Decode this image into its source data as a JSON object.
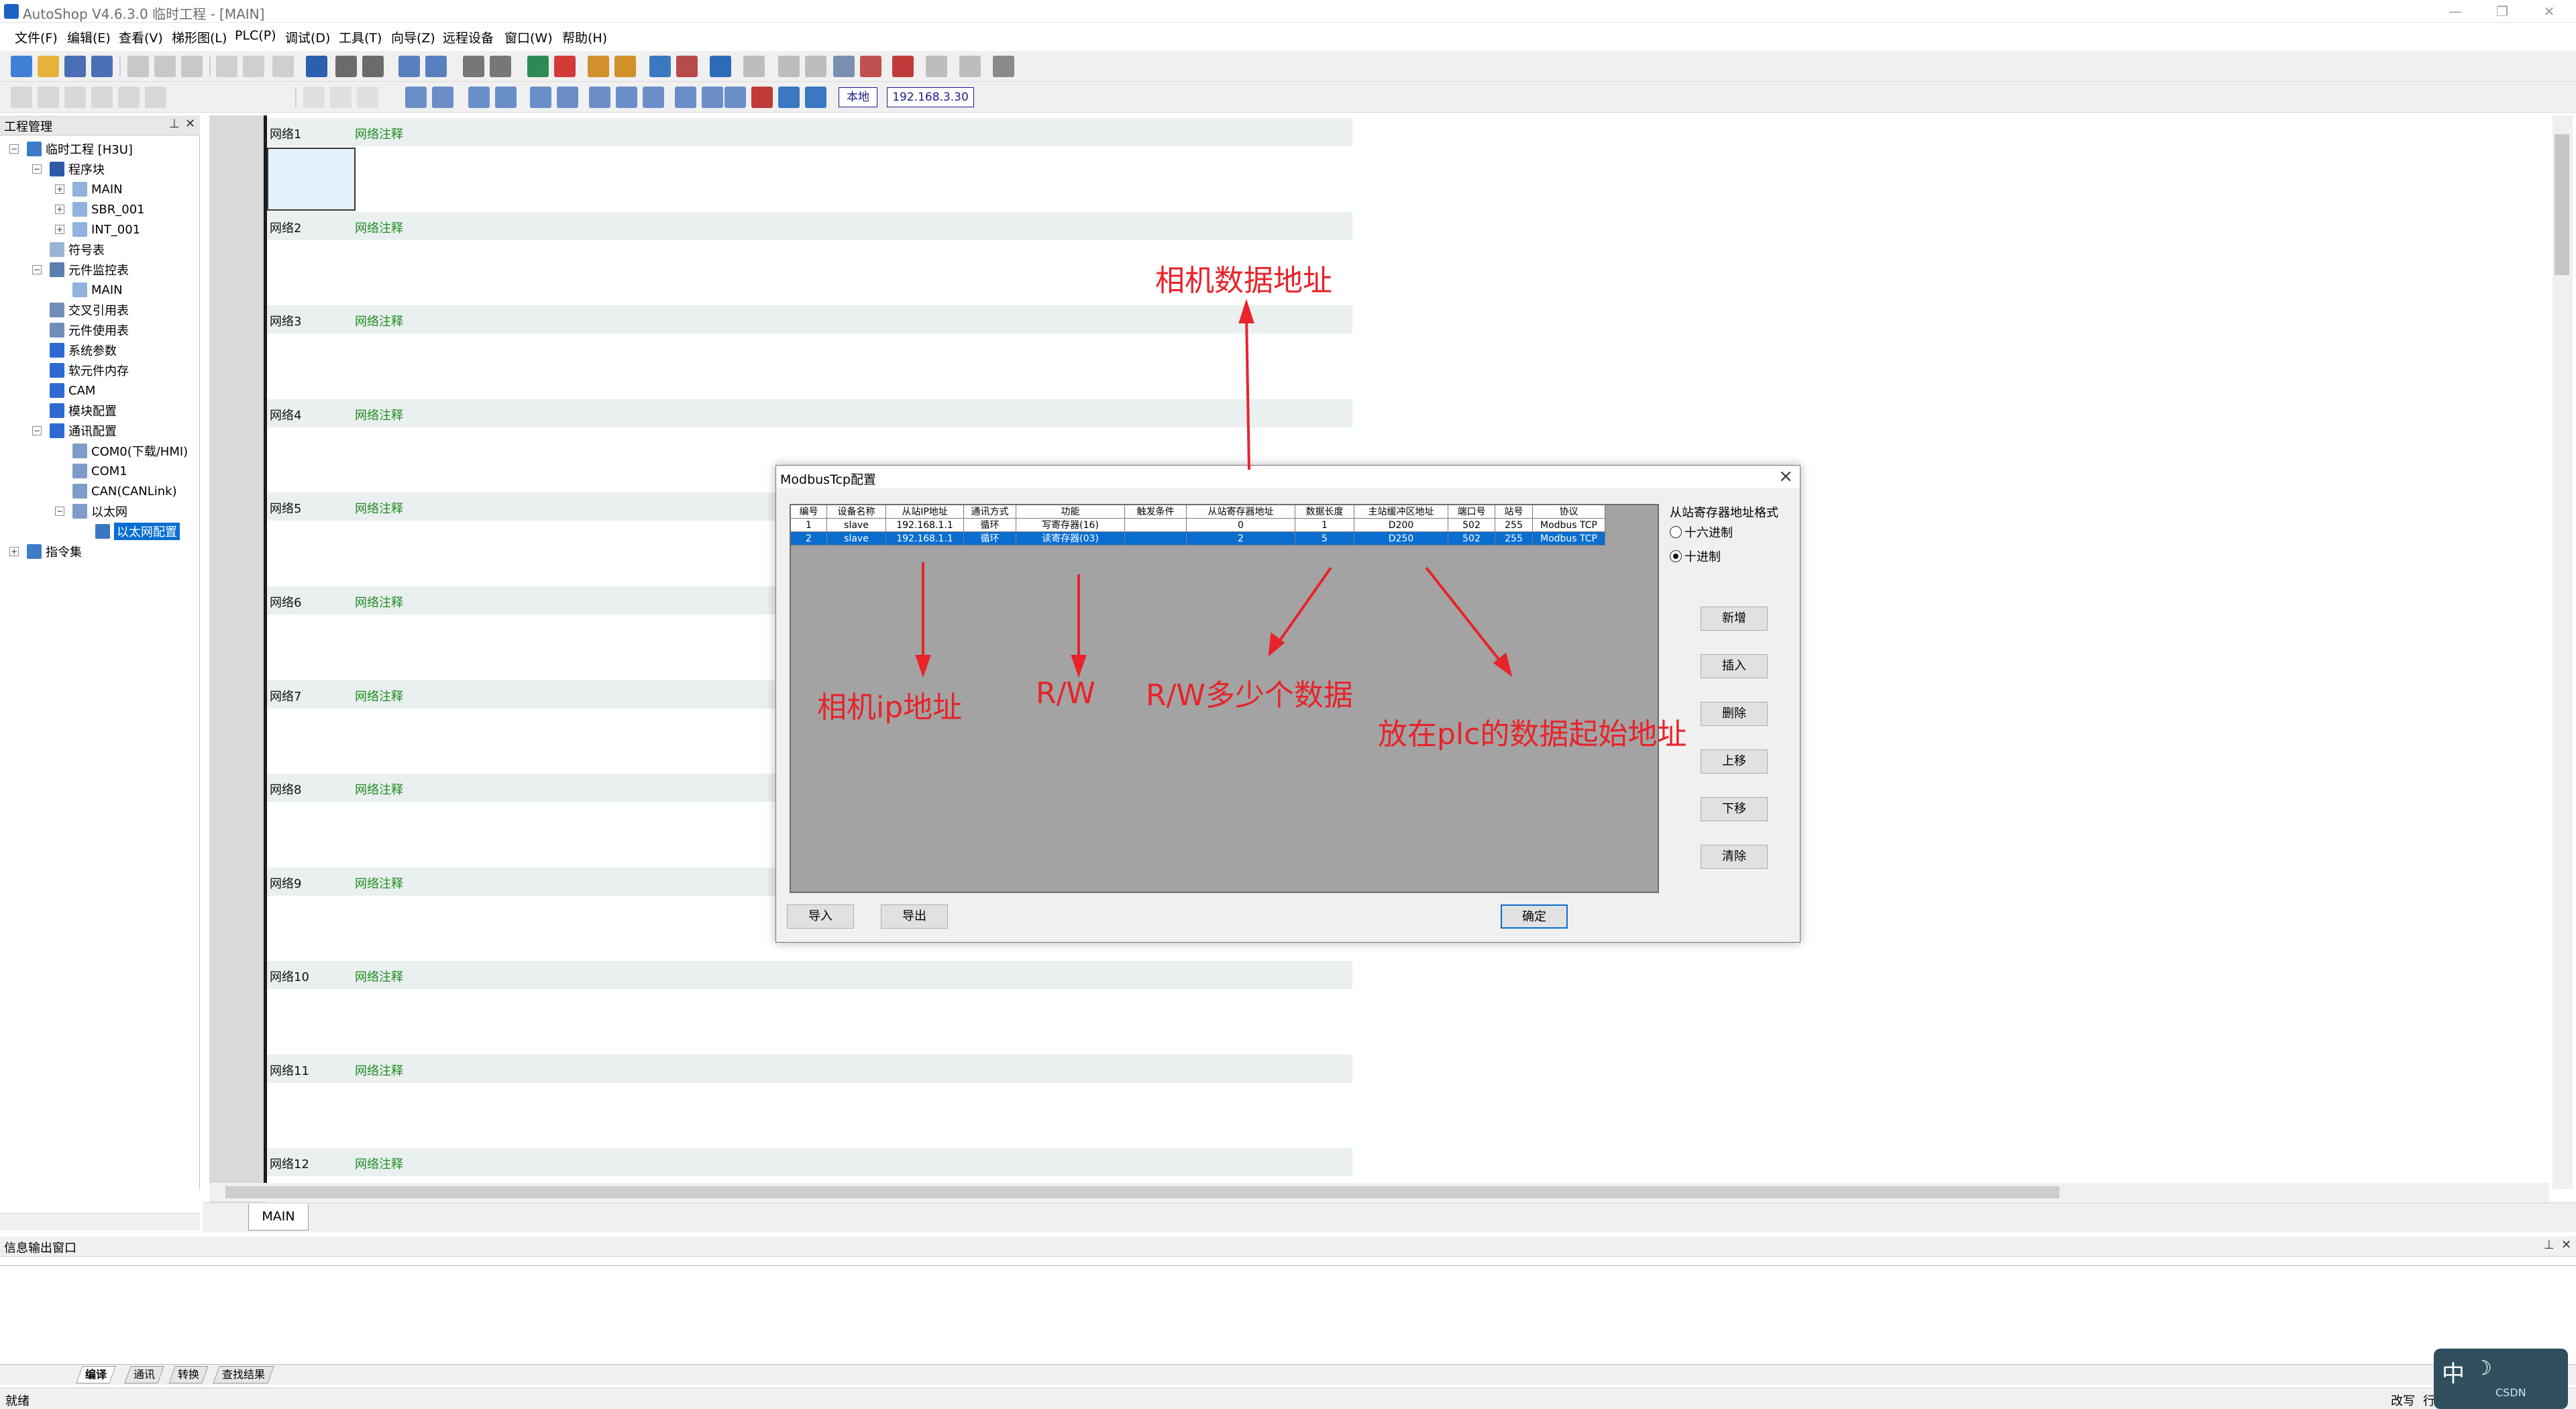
{
  "window": {
    "title": "AutoShop V4.6.3.0  临时工程 - [MAIN]",
    "minimize": "—",
    "restore": "❐",
    "close": "✕"
  },
  "menu": {
    "items": [
      "文件(F)",
      "编辑(E)",
      "查看(V)",
      "梯形图(L)",
      "PLC(P)",
      "调试(D)",
      "工具(T)",
      "向导(Z)",
      "远程设备",
      "窗口(W)",
      "帮助(H)"
    ]
  },
  "toolbar2": {
    "local_label": "本地",
    "ip_value": "192.168.3.30"
  },
  "project_panel": {
    "title": "工程管理",
    "tree": [
      {
        "label": "临时工程 [H3U]"
      },
      {
        "label": "程序块"
      },
      {
        "label": "MAIN"
      },
      {
        "label": "SBR_001"
      },
      {
        "label": "INT_001"
      },
      {
        "label": "符号表"
      },
      {
        "label": "元件监控表"
      },
      {
        "label": "MAIN"
      },
      {
        "label": "交叉引用表"
      },
      {
        "label": "元件使用表"
      },
      {
        "label": "系统参数"
      },
      {
        "label": "软元件内存"
      },
      {
        "label": "CAM"
      },
      {
        "label": "模块配置"
      },
      {
        "label": "通讯配置"
      },
      {
        "label": "COM0(下载/HMI)"
      },
      {
        "label": "COM1"
      },
      {
        "label": "CAN(CANLink)"
      },
      {
        "label": "以太网"
      },
      {
        "label": "以太网配置"
      },
      {
        "label": "指令集"
      }
    ]
  },
  "ladder": {
    "note": "网络注释",
    "networks": [
      "网络1",
      "网络2",
      "网络3",
      "网络4",
      "网络5",
      "网络6",
      "网络7",
      "网络8",
      "网络9",
      "网络10",
      "网络11",
      "网络12"
    ]
  },
  "tabs": {
    "main": "MAIN"
  },
  "output": {
    "title": "信息输出窗口",
    "tabs": [
      "编译",
      "通讯",
      "转换",
      "查找结果"
    ]
  },
  "status": {
    "left": "就绪",
    "right1": "改写",
    "right2": "行"
  },
  "dialog": {
    "title": "ModbusTcp配置",
    "columns": [
      "编号",
      "设备名称",
      "从站IP地址",
      "通讯方式",
      "功能",
      "触发条件",
      "从站寄存器地址",
      "数据长度",
      "主站缓冲区地址",
      "端口号",
      "站号",
      "协议"
    ],
    "rows": [
      [
        "1",
        "slave",
        "192.168.1.1",
        "循环",
        "写寄存器(16)",
        "",
        "0",
        "1",
        "D200",
        "502",
        "255",
        "Modbus TCP"
      ],
      [
        "2",
        "slave",
        "192.168.1.1",
        "循环",
        "读寄存器(03)",
        "",
        "2",
        "5",
        "D250",
        "502",
        "255",
        "Modbus TCP"
      ]
    ],
    "selected_row": 2,
    "format_label": "从站寄存器地址格式",
    "format_options": [
      "十六进制",
      "十进制"
    ],
    "format_selected": "十进制",
    "buttons_side": [
      "新增",
      "插入",
      "删除",
      "上移",
      "下移",
      "清除"
    ],
    "import_label": "导入",
    "export_label": "导出",
    "ok_label": "确定"
  },
  "annotations": {
    "camera_data_addr": "相机数据地址",
    "camera_ip": "相机ip地址",
    "rw": "R/W",
    "rw_count": "R/W多少个数据",
    "plc_start": "放在plc的数据起始地址"
  },
  "tray": {
    "text": "中",
    "watermark": "CSDN"
  },
  "colors": {
    "accent": "#0a6ed1",
    "annotation": "#e8232a",
    "note_green": "#1f8b1f"
  }
}
